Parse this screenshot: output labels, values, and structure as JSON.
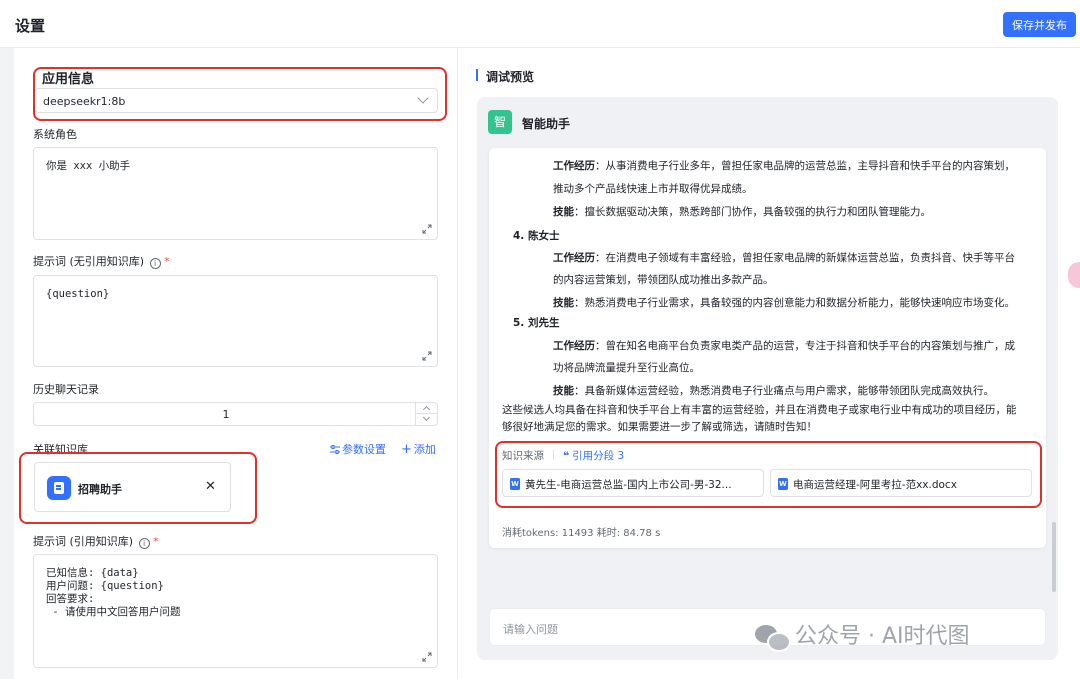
{
  "header": {
    "title": "设置",
    "publish_label": "保存并发布"
  },
  "app_info": {
    "title": "应用信息",
    "model": "deepseekr1:8b"
  },
  "system_role": {
    "label": "系统角色",
    "value": "你是 xxx 小助手"
  },
  "prompt_no_kb": {
    "label": "提示词 (无引用知识库)",
    "info": "i",
    "required": "*",
    "value": "{question}"
  },
  "history": {
    "label": "历史聊天记录",
    "value": "1"
  },
  "knowledge": {
    "label": "关联知识库",
    "param_settings": "参数设置",
    "add": "添加",
    "kb_name": "招聘助手",
    "close": "✕"
  },
  "prompt_kb": {
    "label": "提示词 (引用知识库)",
    "info": "i",
    "required": "*",
    "value": "已知信息: {data}\n用户问题: {question}\n回答要求:\n - 请使用中文回答用户问题"
  },
  "preview": {
    "title": "调试预览",
    "assistant_avatar": "智",
    "assistant_name": "智能助手",
    "lines": [
      {
        "bold": "工作经历",
        "text": "：从事消费电子行业多年，曾担任家电品牌的运营总监，主导抖音和快手平台的内容策划，"
      },
      {
        "bold": "",
        "text": "推动多个产品线快速上市并取得优异成绩。"
      },
      {
        "bold": "技能",
        "text": "：擅长数据驱动决策，熟悉跨部门协作，具备较强的执行力和团队管理能力。"
      },
      {
        "bold": "",
        "text": "4. 陈女士"
      },
      {
        "bold": "工作经历",
        "text": "：在消费电子领域有丰富经验，曾担任家电品牌的新媒体运营总监，负责抖音、快手等平台"
      },
      {
        "bold": "",
        "text": "的内容运营策划，带领团队成功推出多款产品。"
      },
      {
        "bold": "技能",
        "text": "：熟悉消费电子行业需求，具备较强的内容创意能力和数据分析能力，能够快速响应市场变化。"
      },
      {
        "bold": "",
        "text": "5. 刘先生"
      },
      {
        "bold": "工作经历",
        "text": "：曾在知名电商平台负责家电类产品的运营，专注于抖音和快手平台的内容策划与推广，成"
      },
      {
        "bold": "",
        "text": "功将品牌流量提升至行业高位。"
      },
      {
        "bold": "技能",
        "text": "：具备新媒体运营经验，熟悉消费电子行业痛点与用户需求，能够带领团队完成高效执行。"
      },
      {
        "bold": "",
        "text": "这些候选人均具备在抖音和快手平台上有丰富的运营经验，并且在消费电子或家电行业中有成功的项目经历，能"
      },
      {
        "bold": "",
        "text": "够很好地满足您的需求。如果需要进一步了解或筛选，请随时告知！"
      }
    ],
    "kb_source_label": "知识来源",
    "quote_label": "引用分段 3",
    "docs": [
      "黄先生-电商运营总监-国内上市公司-男-32...",
      "电商运营经理-阿里考拉-范xx.docx"
    ],
    "doc_icon_letter": "W",
    "tokens": "消耗tokens: 11493  耗时: 84.78 s",
    "input_placeholder": "请输入问题",
    "watermark": "公众号 · AI时代图"
  }
}
